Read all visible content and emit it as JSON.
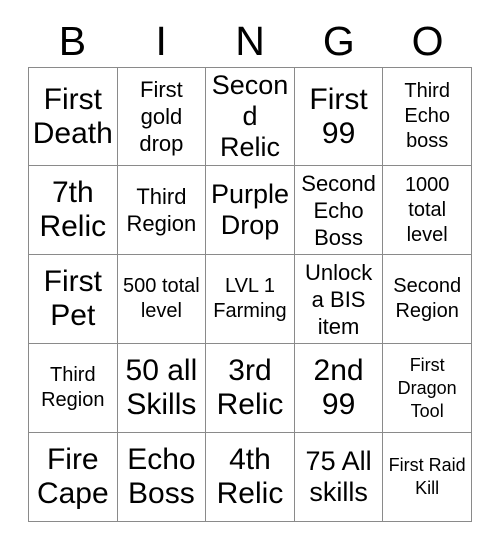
{
  "card": {
    "title": "BINGO",
    "headers": [
      "B",
      "I",
      "N",
      "G",
      "O"
    ],
    "rows": [
      [
        {
          "text": "First Death",
          "size": "xl"
        },
        {
          "text": "First gold drop",
          "size": "md"
        },
        {
          "text": "Second Relic",
          "size": "lg"
        },
        {
          "text": "First 99",
          "size": "xl"
        },
        {
          "text": "Third Echo boss",
          "size": "sm"
        }
      ],
      [
        {
          "text": "7th Relic",
          "size": "xl"
        },
        {
          "text": "Third Region",
          "size": "md"
        },
        {
          "text": "Purple Drop",
          "size": "lg"
        },
        {
          "text": "Second Echo Boss",
          "size": "md"
        },
        {
          "text": "1000 total level",
          "size": "sm"
        }
      ],
      [
        {
          "text": "First Pet",
          "size": "xl"
        },
        {
          "text": "500 total level",
          "size": "sm"
        },
        {
          "text": "LVL 1 Farming",
          "size": "sm"
        },
        {
          "text": "Unlock a BIS item",
          "size": "md"
        },
        {
          "text": "Second Region",
          "size": "sm"
        }
      ],
      [
        {
          "text": "Third Region",
          "size": "sm"
        },
        {
          "text": "50 all Skills",
          "size": "xl"
        },
        {
          "text": "3rd Relic",
          "size": "xl"
        },
        {
          "text": "2nd 99",
          "size": "xl"
        },
        {
          "text": "First Dragon Tool",
          "size": "xs"
        }
      ],
      [
        {
          "text": "Fire Cape",
          "size": "xl"
        },
        {
          "text": "Echo Boss",
          "size": "xl"
        },
        {
          "text": "4th Relic",
          "size": "xl"
        },
        {
          "text": "75 All skills",
          "size": "lg"
        },
        {
          "text": "First Raid Kill",
          "size": "xs"
        }
      ]
    ]
  },
  "colors": {
    "background": "#ffffff",
    "text": "#000000",
    "grid_line": "#8a8a8a"
  }
}
